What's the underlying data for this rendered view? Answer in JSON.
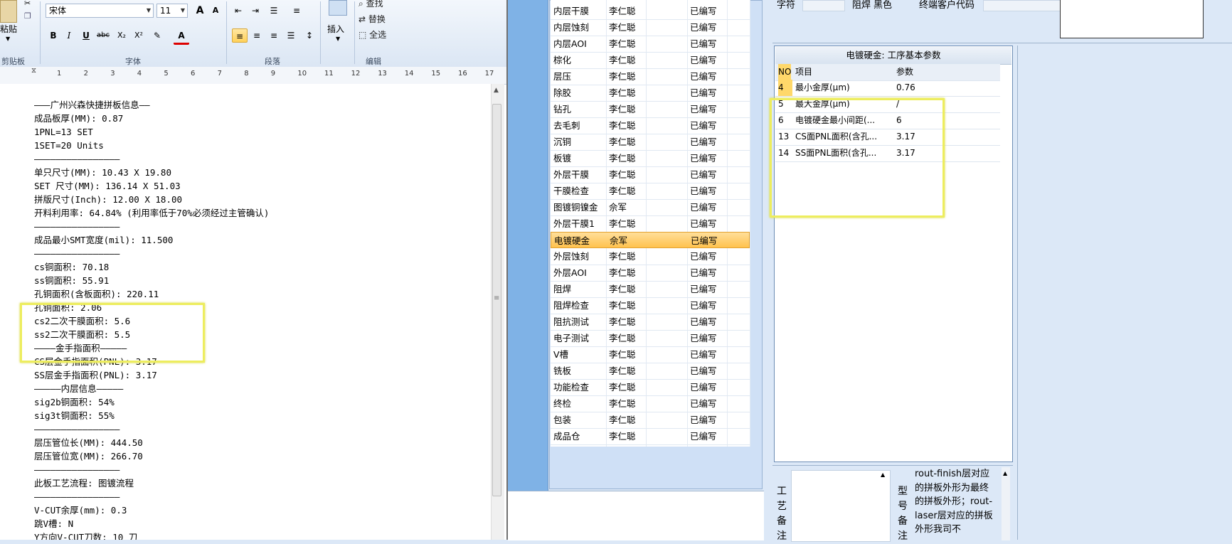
{
  "ribbon": {
    "paste_label": "粘贴",
    "clipboard_group": "剪贴板",
    "font_name": "宋体",
    "font_size": "11",
    "font_group": "字体",
    "paragraph_group": "段落",
    "insert_label": "插入",
    "find_label": "查找",
    "replace_label": "替换",
    "select_all_label": "全选",
    "edit_group": "编辑",
    "bold": "B",
    "italic": "I",
    "underline": "U",
    "strike": "abc",
    "sub": "X₂",
    "sup": "X²",
    "font_color": "A",
    "grow": "A",
    "shrink": "A"
  },
  "ruler": [
    "1",
    "2",
    "3",
    "4",
    "5",
    "6",
    "7",
    "8",
    "9",
    "10",
    "11",
    "12",
    "13",
    "14",
    "15",
    "16",
    "17"
  ],
  "document": {
    "lines": [
      "———广州兴森快捷拼板信息——",
      "成品板厚(MM): 0.87",
      "1PNL=13 SET",
      "1SET=20 Units",
      "————————————————",
      "单只尺寸(MM): 10.43 X 19.80",
      "SET 尺寸(MM): 136.14 X 51.03",
      "拼版尺寸(Inch): 12.00 X 18.00",
      "开料利用率: 64.84% (利用率低于70%必须经过主管确认)",
      "————————————————",
      "成品最小SMT宽度(mil): 11.500",
      "————————————————",
      "cs铜面积: 70.18",
      "ss铜面积: 55.91",
      "孔铜面积(含板面积): 220.11",
      "孔铜面积: 2.06",
      "cs2二次干膜面积: 5.6",
      "ss2二次干膜面积: 5.5",
      "————金手指面积—————",
      "CS层金手指面积(PNL): 3.17",
      "SS层金手指面积(PNL): 3.17",
      "—————内层信息—————",
      "sig2b铜面积: 54%",
      "sig3t铜面积: 55%",
      "————————————————",
      "层压管位长(MM): 444.50",
      "层压管位宽(MM): 266.70",
      "————————————————",
      "此板工艺流程: 图镀流程",
      "————————————————",
      "V-CUT余厚(mm): 0.3",
      "跳V槽: N",
      "Y方向V-CUT刀数: 10 刀"
    ]
  },
  "steps": [
    {
      "name": "内层干膜",
      "person": "李仁聪",
      "status": "已编写"
    },
    {
      "name": "内层蚀刻",
      "person": "李仁聪",
      "status": "已编写"
    },
    {
      "name": "内层AOI",
      "person": "李仁聪",
      "status": "已编写"
    },
    {
      "name": "棕化",
      "person": "李仁聪",
      "status": "已编写"
    },
    {
      "name": "层压",
      "person": "李仁聪",
      "status": "已编写"
    },
    {
      "name": "除胶",
      "person": "李仁聪",
      "status": "已编写"
    },
    {
      "name": "钻孔",
      "person": "李仁聪",
      "status": "已编写"
    },
    {
      "name": "去毛刺",
      "person": "李仁聪",
      "status": "已编写"
    },
    {
      "name": "沉铜",
      "person": "李仁聪",
      "status": "已编写"
    },
    {
      "name": "板镀",
      "person": "李仁聪",
      "status": "已编写"
    },
    {
      "name": "外层干膜",
      "person": "李仁聪",
      "status": "已编写"
    },
    {
      "name": "干膜检查",
      "person": "李仁聪",
      "status": "已编写"
    },
    {
      "name": "图镀铜镍金",
      "person": "佘军",
      "status": "已编写"
    },
    {
      "name": "外层干膜1",
      "person": "李仁聪",
      "status": "已编写"
    },
    {
      "name": "电镀硬金",
      "person": "佘军",
      "status": "已编写"
    },
    {
      "name": "外层蚀刻",
      "person": "李仁聪",
      "status": "已编写"
    },
    {
      "name": "外层AOI",
      "person": "李仁聪",
      "status": "已编写"
    },
    {
      "name": "阻焊",
      "person": "李仁聪",
      "status": "已编写"
    },
    {
      "name": "阻焊检查",
      "person": "李仁聪",
      "status": "已编写"
    },
    {
      "name": "阻抗测试",
      "person": "李仁聪",
      "status": "已编写"
    },
    {
      "name": "电子测试",
      "person": "李仁聪",
      "status": "已编写"
    },
    {
      "name": "V槽",
      "person": "李仁聪",
      "status": "已编写"
    },
    {
      "name": "铣板",
      "person": "李仁聪",
      "status": "已编写"
    },
    {
      "name": "功能检查",
      "person": "李仁聪",
      "status": "已编写"
    },
    {
      "name": "终检",
      "person": "李仁聪",
      "status": "已编写"
    },
    {
      "name": "包装",
      "person": "李仁聪",
      "status": "已编写"
    },
    {
      "name": "成品仓",
      "person": "李仁聪",
      "status": "已编写"
    }
  ],
  "top_fields": {
    "char_label": "字符",
    "solder_label": "阻焊",
    "solder_value": "黑色",
    "customer_code_label": "终端客户代码"
  },
  "params": {
    "title": "电镀硬金: 工序基本参数",
    "headers": [
      "NO",
      "项目",
      "参数"
    ],
    "rows": [
      {
        "no": "4",
        "item": "最小金厚(μm)",
        "value": "0.76"
      },
      {
        "no": "5",
        "item": "最大金厚(μm)",
        "value": "/"
      },
      {
        "no": "6",
        "item": "电镀硬金最小间距(...",
        "value": "6"
      },
      {
        "no": "13",
        "item": "CS面PNL面积(含孔...",
        "value": "3.17"
      },
      {
        "no": "14",
        "item": "SS面PNL面积(含孔...",
        "value": "3.17"
      }
    ]
  },
  "notes": {
    "process_label": "工艺备注",
    "model_label": "型号备注",
    "text": "rout-finish层对应的拼板外形为最终的拼板外形；rout-laser层对应的拼板外形我司不"
  }
}
